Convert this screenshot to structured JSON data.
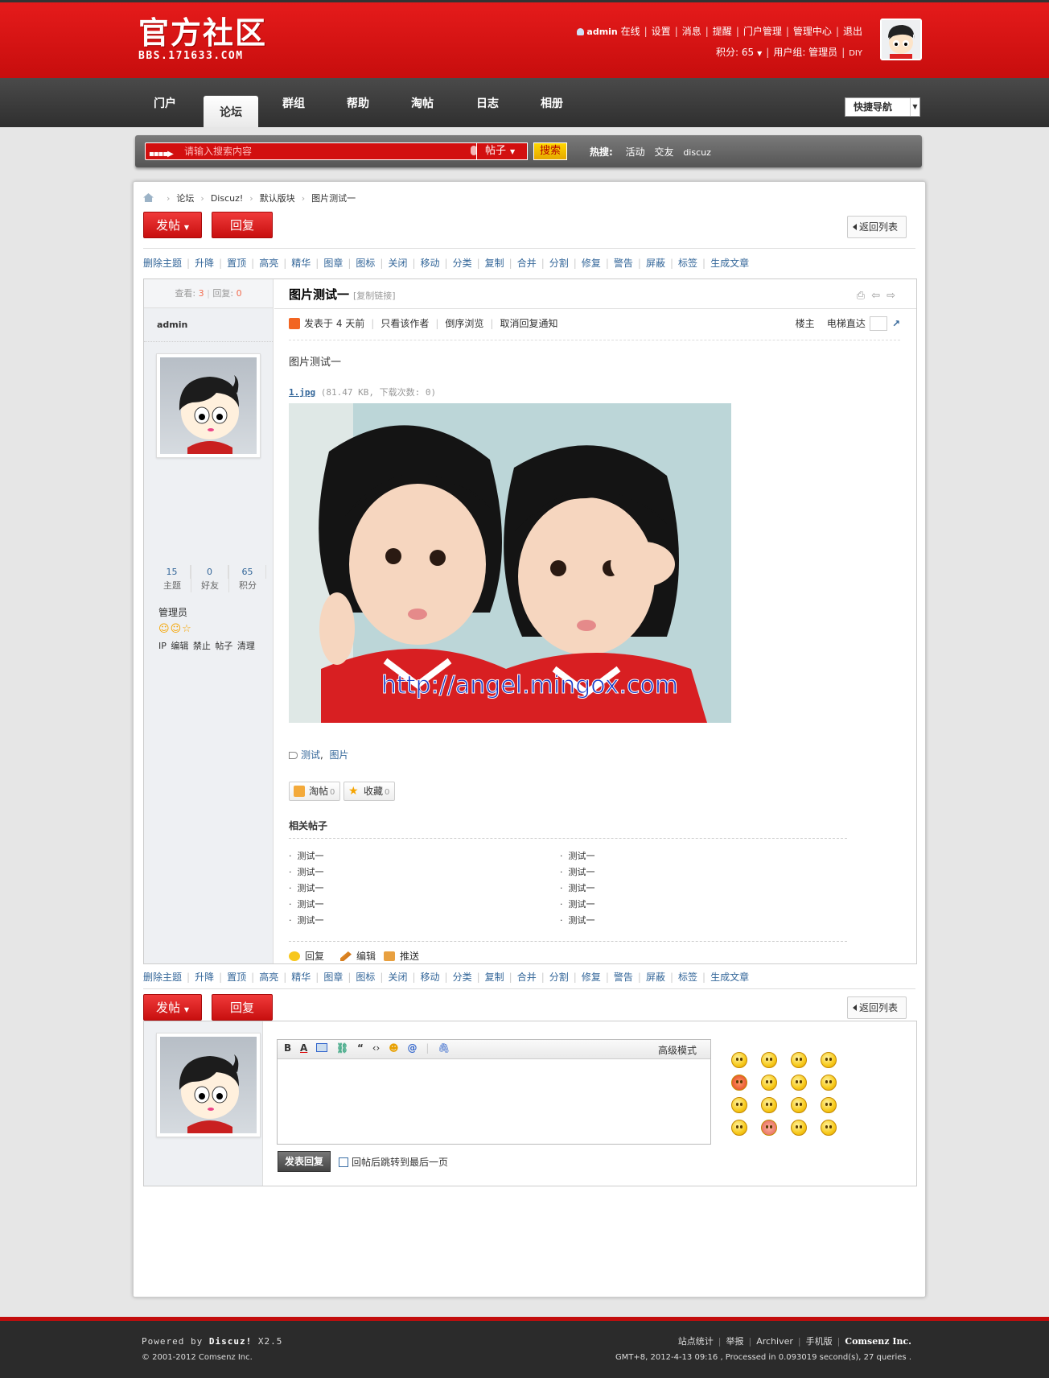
{
  "header": {
    "logo_title": "官方社区",
    "logo_url": "BBS.171633.COM",
    "username": "admin",
    "online": "在线",
    "links": [
      "设置",
      "消息",
      "提醒",
      "门户管理",
      "管理中心",
      "退出"
    ],
    "credits_label": "积分: 65",
    "usergroup_label": "用户组: 管理员",
    "diy": "DIY"
  },
  "nav": {
    "items": [
      "门户",
      "论坛",
      "群组",
      "帮助",
      "淘帖",
      "日志",
      "相册"
    ],
    "active": "论坛",
    "quick_nav": "快捷导航"
  },
  "search": {
    "placeholder": "请输入搜索内容",
    "type": "帖子",
    "button": "搜索",
    "hot_label": "热搜:",
    "hot": [
      "活动",
      "交友",
      "discuz"
    ]
  },
  "breadcrumb": [
    "论坛",
    "Discuz!",
    "默认版块",
    "图片测试一"
  ],
  "buttons": {
    "post": "发帖",
    "reply": "回复",
    "back": "返回列表"
  },
  "mod_actions": [
    "删除主题",
    "升降",
    "置顶",
    "高亮",
    "精华",
    "图章",
    "图标",
    "关闭",
    "移动",
    "分类",
    "复制",
    "合并",
    "分割",
    "修复",
    "警告",
    "屏蔽",
    "标签",
    "生成文章"
  ],
  "thread": {
    "views_label": "查看:",
    "views": "3",
    "replies_label": "回复:",
    "replies": "0",
    "title": "图片测试一",
    "copy_link": "[复制链接]"
  },
  "author": {
    "name": "admin",
    "stats": [
      {
        "value": "15",
        "label": "主题"
      },
      {
        "value": "0",
        "label": "好友"
      },
      {
        "value": "65",
        "label": "积分"
      }
    ],
    "group": "管理员",
    "admin_links": "IP 编辑 禁止 帖子 清理"
  },
  "post": {
    "posted": "发表于 4 天前",
    "only_author": "只看该作者",
    "reverse": "倒序浏览",
    "cancel_notify": "取消回复通知",
    "floor": "楼主",
    "jump": "电梯直达",
    "body": "图片测试一",
    "attachment_name": "1.jpg",
    "attachment_info": "(81.47 KB, 下载次数: 0)",
    "image_watermark": "http://angel.mingox.com",
    "tags": [
      "测试",
      "图片"
    ],
    "taotie_label": "淘帖",
    "taotie_count": "0",
    "favorite_label": "收藏",
    "favorite_count": "0",
    "related_title": "相关帖子",
    "related": [
      "测试一",
      "测试一",
      "测试一",
      "测试一",
      "测试一",
      "测试一",
      "测试一",
      "测试一",
      "测试一",
      "测试一"
    ],
    "actions": [
      "回复",
      "编辑",
      "推送"
    ]
  },
  "reply_box": {
    "advanced": "高级模式",
    "submit": "发表回复",
    "checkbox_label": "回帖后跳转到最后一页"
  },
  "footer": {
    "powered_prefix": "Powered by ",
    "powered_brand": "Discuz!",
    "powered_version": " X2.5",
    "copyright": "© 2001-2012 Comsenz Inc.",
    "links": [
      "站点统计",
      "举报",
      "Archiver",
      "手机版"
    ],
    "company": "Comsenz Inc.",
    "stats": "GMT+8, 2012-4-13 09:16 , Processed in 0.093019 second(s), 27 queries ."
  },
  "colors": {
    "brand_red": "#d20f0f",
    "link_blue": "#336699",
    "footer_bg": "#2b2b2b"
  }
}
